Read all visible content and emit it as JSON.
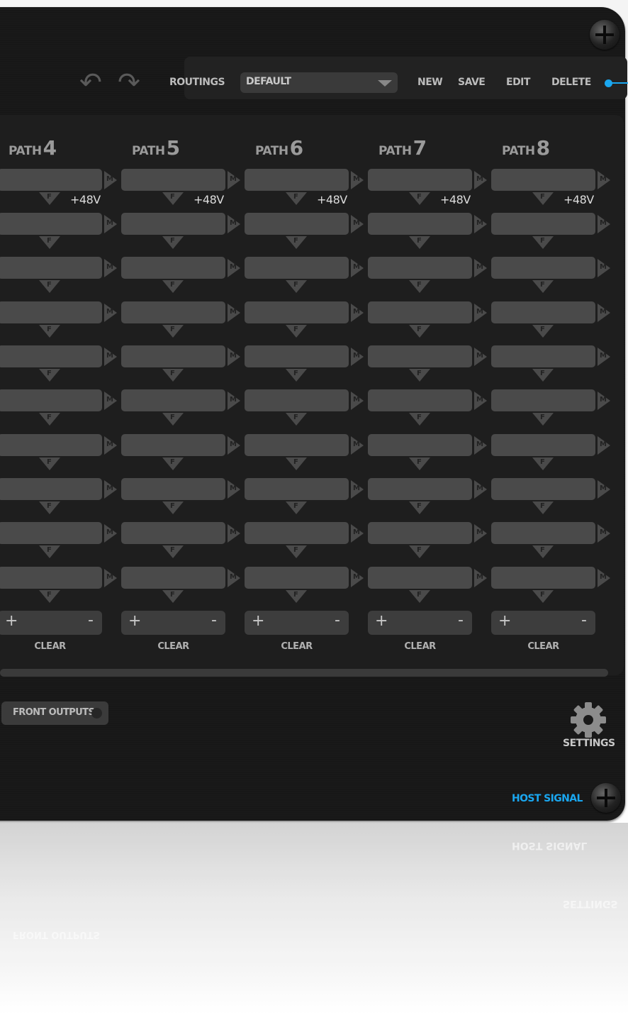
{
  "toolbar": {
    "routings_label": "ROUTINGS",
    "routing_value": "DEFAULT",
    "new_label": "NEW",
    "save_label": "SAVE",
    "edit_label": "EDIT",
    "delete_label": "DELETE"
  },
  "paths": [
    {
      "word": "PATH",
      "num": "4",
      "phantom": "+48V",
      "clear": "CLEAR"
    },
    {
      "word": "PATH",
      "num": "5",
      "phantom": "+48V",
      "clear": "CLEAR"
    },
    {
      "word": "PATH",
      "num": "6",
      "phantom": "+48V",
      "clear": "CLEAR"
    },
    {
      "word": "PATH",
      "num": "7",
      "phantom": "+48V",
      "clear": "CLEAR"
    },
    {
      "word": "PATH",
      "num": "8",
      "phantom": "+48V",
      "clear": "CLEAR"
    }
  ],
  "slot_symbols": {
    "m": "M",
    "f": "F"
  },
  "stepper": {
    "plus": "+",
    "minus": "-"
  },
  "footer": {
    "front_outputs": "FRONT OUTPUTS",
    "settings": "SETTINGS",
    "host_signal": "HOST SIGNAL"
  },
  "colors": {
    "accent": "#1aa7f0",
    "panel": "#1e1e1e",
    "slot": "#4a4a4a"
  }
}
